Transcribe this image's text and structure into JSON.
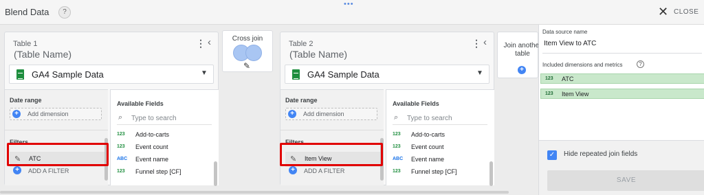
{
  "header": {
    "title": "Blend Data",
    "help_glyph": "?",
    "drag_dots": "•••",
    "close_label": "CLOSE"
  },
  "tables": [
    {
      "label": "Table 1",
      "name": "(Table Name)",
      "data_source": "GA4 Sample Data",
      "date_range_label": "Date range",
      "add_dimension": "Add dimension",
      "filters_label": "Filters",
      "filter_item": "ATC",
      "add_filter": "ADD A FILTER",
      "available_fields_label": "Available Fields",
      "search_placeholder": "Type to search",
      "fields": [
        {
          "type": "123",
          "name": "Add-to-carts"
        },
        {
          "type": "123",
          "name": "Event count"
        },
        {
          "type": "ABC",
          "name": "Event name"
        },
        {
          "type": "123",
          "name": "Funnel step [CF]"
        }
      ]
    },
    {
      "label": "Table 2",
      "name": "(Table Name)",
      "data_source": "GA4 Sample Data",
      "date_range_label": "Date range",
      "add_dimension": "Add dimension",
      "filters_label": "Filters",
      "filter_item": "Item View",
      "add_filter": "ADD A FILTER",
      "available_fields_label": "Available Fields",
      "search_placeholder": "Type to search",
      "fields": [
        {
          "type": "123",
          "name": "Add-to-carts"
        },
        {
          "type": "123",
          "name": "Event count"
        },
        {
          "type": "ABC",
          "name": "Event name"
        },
        {
          "type": "123",
          "name": "Funnel step [CF]"
        }
      ]
    }
  ],
  "cross_join": {
    "label": "Cross join"
  },
  "join_another": {
    "label": "Join another table"
  },
  "panel": {
    "data_source_name_label": "Data source name",
    "data_source_name_value": "Item View to ATC",
    "included_label": "Included dimensions and metrics",
    "included_items": [
      {
        "type": "123",
        "name": "ATC"
      },
      {
        "type": "123",
        "name": "Item View"
      }
    ],
    "hide_repeated_label": "Hide repeated join fields",
    "save_label": "SAVE"
  },
  "colors": {
    "accent": "#4285f4",
    "highlight": "#e10000",
    "chip_bg": "#c9e8cb",
    "sheets_green": "#1e8e3e"
  }
}
